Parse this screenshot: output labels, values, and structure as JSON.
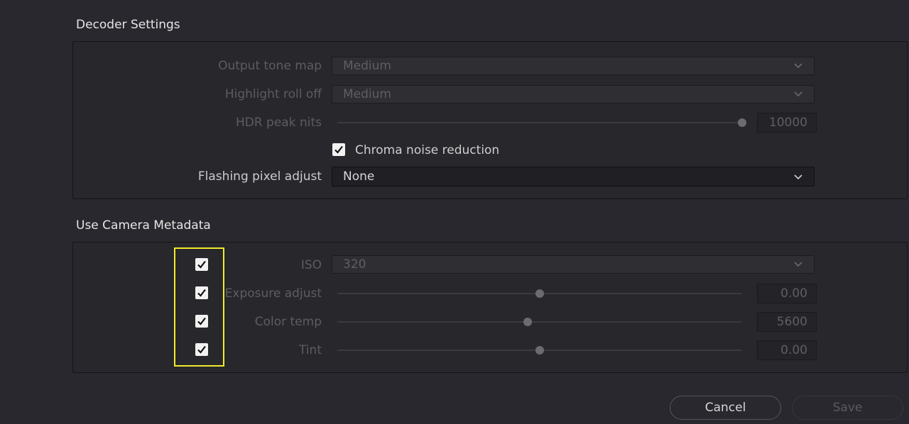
{
  "decoder_settings": {
    "title": "Decoder Settings",
    "output_tone_map": {
      "label": "Output tone map",
      "value": "Medium"
    },
    "highlight_roll_off": {
      "label": "Highlight roll off",
      "value": "Medium"
    },
    "hdr_peak_nits": {
      "label": "HDR peak nits",
      "value": "10000",
      "slider_fraction": 1.0
    },
    "chroma_noise_reduction": {
      "label": "Chroma noise reduction",
      "checked": true
    },
    "flashing_pixel_adjust": {
      "label": "Flashing pixel adjust",
      "value": "None"
    }
  },
  "camera_metadata": {
    "title": "Use Camera Metadata",
    "iso": {
      "label": "ISO",
      "value": "320",
      "checked": true
    },
    "exposure_adjust": {
      "label": "Exposure adjust",
      "value": "0.00",
      "checked": true,
      "slider_fraction": 0.5
    },
    "color_temp": {
      "label": "Color temp",
      "value": "5600",
      "checked": true,
      "slider_fraction": 0.47
    },
    "tint": {
      "label": "Tint",
      "value": "0.00",
      "checked": true,
      "slider_fraction": 0.5
    }
  },
  "buttons": {
    "cancel": "Cancel",
    "save": "Save"
  },
  "colors": {
    "background": "#28282e",
    "highlight": "#f3ea2a",
    "checkbox": "#f2f2f2"
  }
}
